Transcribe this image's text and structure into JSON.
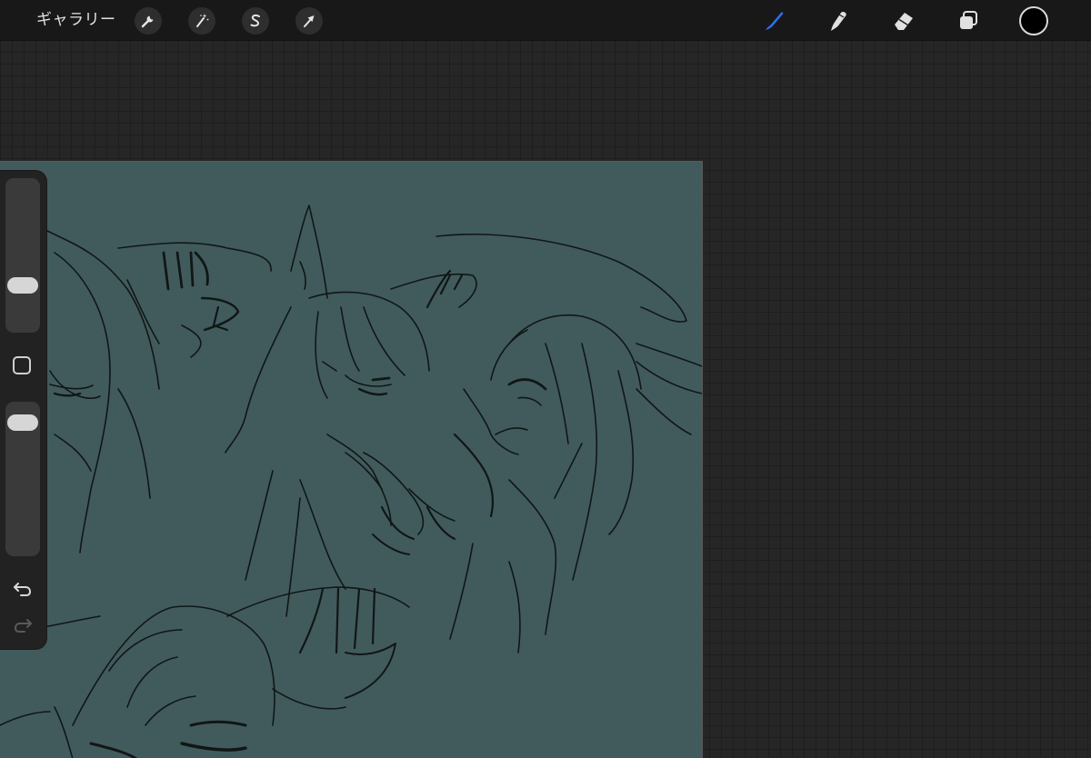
{
  "topbar": {
    "gallery_label": "ギャラリー",
    "left_tools": [
      {
        "name": "actions",
        "icon": "wrench-icon"
      },
      {
        "name": "adjustments",
        "icon": "magic-wand-icon"
      },
      {
        "name": "selection",
        "icon": "selection-s-icon"
      },
      {
        "name": "transform",
        "icon": "arrow-cursor-icon"
      }
    ],
    "right_tools": [
      {
        "name": "brush",
        "icon": "brush-icon",
        "active": true
      },
      {
        "name": "smudge",
        "icon": "smudge-finger-icon",
        "active": false
      },
      {
        "name": "eraser",
        "icon": "eraser-icon",
        "active": false
      },
      {
        "name": "layers",
        "icon": "layers-icon",
        "active": false
      }
    ],
    "current_color": "#000000"
  },
  "sidebar": {
    "brush_size_level": 0.28,
    "opacity_level": 0.92,
    "modifier_icon": "square-modifier-icon",
    "undo_icon": "undo-icon",
    "redo_icon": "redo-icon",
    "redo_enabled": false
  },
  "canvas": {
    "background_color": "#415b5c",
    "stroke_color": "#111616",
    "content": "sketch-drawing"
  },
  "colors": {
    "workspace": "#262626",
    "topbar": "#181818",
    "accent_active_tool": "#2f6ff0",
    "icon": "#e0e0e0"
  }
}
